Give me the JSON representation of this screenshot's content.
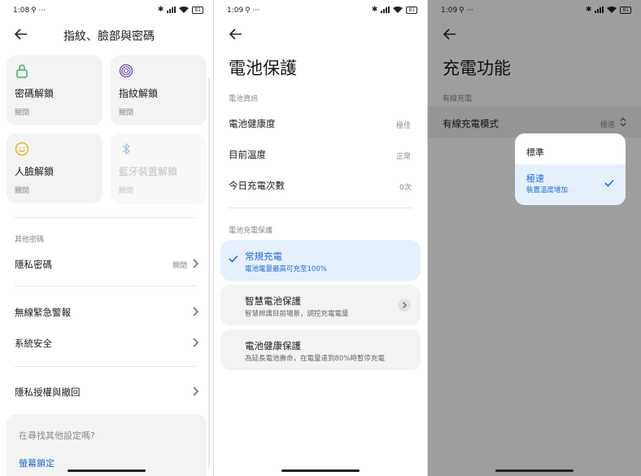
{
  "panel1": {
    "status_time": "1:08",
    "status_extra": "⚲ ···",
    "battery": "81",
    "title": "指紋、臉部與密碼",
    "cards": [
      {
        "title": "密碼解鎖",
        "sub": "關閉"
      },
      {
        "title": "指紋解鎖",
        "sub": "關閉"
      },
      {
        "title": "人臉解鎖",
        "sub": "關閉"
      },
      {
        "title": "藍牙裝置解鎖",
        "sub": "關閉"
      }
    ],
    "other_section": "其他密碼",
    "rows": [
      {
        "label": "隱私密碼",
        "value": "關閉"
      },
      {
        "label": "無線緊急警報"
      },
      {
        "label": "系統安全"
      },
      {
        "label": "隱私授權與撤回"
      }
    ],
    "find_question": "在尋找其他設定嗎?",
    "find_link": "螢幕鎖定"
  },
  "panel2": {
    "status_time": "1:09",
    "status_extra": "⚲ ···",
    "battery": "81",
    "title": "電池保護",
    "info_section": "電池資訊",
    "info_rows": [
      {
        "label": "電池健康度",
        "value": "極佳"
      },
      {
        "label": "目前溫度",
        "value": "正常"
      },
      {
        "label": "今日充電次數",
        "value": "0次"
      }
    ],
    "protect_section": "電池充電保護",
    "options": [
      {
        "title": "常規充電",
        "sub": "電池電量最高可充至100%"
      },
      {
        "title": "智慧電池保護",
        "sub": "智慧辨識目前場景，調控充電電量"
      },
      {
        "title": "電池健康保護",
        "sub": "為延長電池壽命，在電量達到80%時暫停充電"
      }
    ]
  },
  "panel3": {
    "status_time": "1:09",
    "status_extra": "⚲ ···",
    "battery": "81",
    "title": "充電功能",
    "section": "有線充電",
    "row_label": "有線充電模式",
    "row_value": "極速",
    "popup": {
      "standard": "標準",
      "fast": "極速",
      "fast_sub": "裝置溫度增加"
    }
  },
  "colors": {
    "accent": "#1e6bd6",
    "green_icon": "#3cb371",
    "yellow_icon": "#e8b820",
    "purple_icon": "#6a4fa0"
  }
}
